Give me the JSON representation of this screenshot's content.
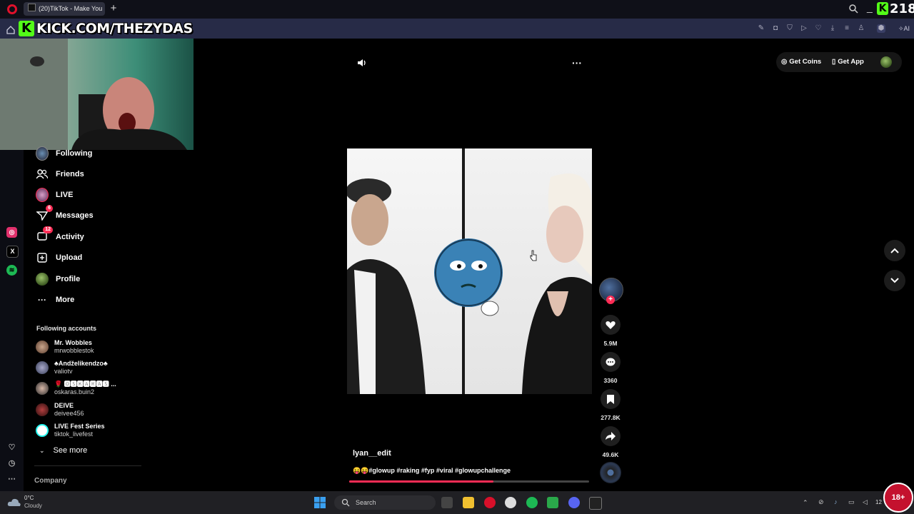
{
  "browser": {
    "tab_title": "(20)TikTok - Make You",
    "kick_url": "KICK.COM/THEZYDAS",
    "kick_logo": "K",
    "viewer_count": "218"
  },
  "nav": {
    "items": [
      {
        "label": "Following",
        "icon": "following-avatar-icon"
      },
      {
        "label": "Friends",
        "icon": "friends-icon"
      },
      {
        "label": "LIVE",
        "icon": "live-icon"
      },
      {
        "label": "Messages",
        "icon": "messages-icon",
        "badge": "6"
      },
      {
        "label": "Activity",
        "icon": "activity-icon",
        "badge": "12"
      },
      {
        "label": "Upload",
        "icon": "upload-icon"
      },
      {
        "label": "Profile",
        "icon": "profile-icon"
      },
      {
        "label": "More",
        "icon": "more-icon"
      }
    ],
    "following_title": "Following accounts",
    "accounts": [
      {
        "display": "Mr. Wobbles",
        "user": "mrwobblestok"
      },
      {
        "display": "♣Andželikendzo♣",
        "user": "valiotv"
      },
      {
        "display": "🌹 🅾🆂🅺🅰🆁🅰🆂 ...",
        "user": "oskaras.buin2"
      },
      {
        "display": "DEIVE",
        "user": "deivee456"
      },
      {
        "display": "LIVE Fest Series",
        "user": "tiktok_livefest"
      }
    ],
    "see_more": "See more",
    "company": "Company"
  },
  "header": {
    "get_coins": "Get Coins",
    "get_app": "Get App"
  },
  "video": {
    "author": "lyan__edit",
    "caption": "😝😝#glowup #raking #fyp #viral #glowupchallenge",
    "likes": "5.9M",
    "comments": "3360",
    "saves": "277.8K",
    "shares": "49.6K",
    "progress": 0.6
  },
  "taskbar": {
    "temp": "0°C",
    "weather": "Cloudy",
    "search_placeholder": "Search",
    "clock": "12",
    "age_badge": "18+"
  },
  "colors": {
    "accent": "#fe2c55",
    "kick_green": "#53fc18"
  }
}
